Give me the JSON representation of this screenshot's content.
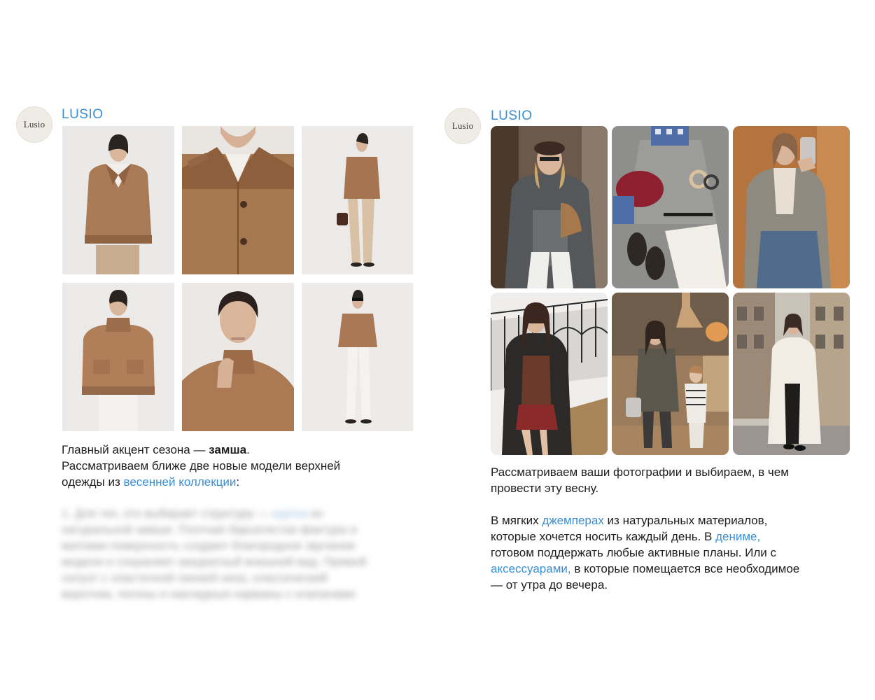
{
  "left_post": {
    "avatar_text": "Lusio",
    "channel_name": "LUSIO",
    "photos": [
      {
        "icon": "suede-bomber-front-photo-icon"
      },
      {
        "icon": "suede-collar-closeup-photo-icon"
      },
      {
        "icon": "suede-jacket-beige-trousers-photo-icon"
      },
      {
        "icon": "suede-jacket-white-trousers-photo-icon"
      },
      {
        "icon": "model-portrait-suede-photo-icon"
      },
      {
        "icon": "full-look-sunglasses-photo-icon"
      }
    ],
    "text": {
      "line1_prefix": "Главный акцент сезона — ",
      "line1_bold": "замша",
      "line1_suffix": ".",
      "line2": "Рассматриваем ближе две новые модели верхней",
      "line3_prefix": "одежды из ",
      "line3_link": "весенней коллекции",
      "line3_suffix": ":"
    },
    "blurred_text": {
      "l1_prefix": "1. Для тех, кто выбирает структуру — ",
      "l1_link": "куртка",
      "l1_suffix": " из",
      "l2": "натуральной замши. Плотная бархатистая фактура и",
      "l3": "матовая поверхность создают благородное звучание",
      "l4": "модели и сохраняют аккуратный внешний вид. Прямой",
      "l5": "силуэт с эластичной линией низа, классический",
      "l6": "воротник, погоны и накладные карманы с клапанами"
    }
  },
  "right_post": {
    "avatar_text": "Lusio",
    "channel_name": "LUSIO",
    "photos": [
      {
        "icon": "street-beret-coat-photo-icon"
      },
      {
        "icon": "flatlay-outfit-photo-icon"
      },
      {
        "icon": "mirror-selfie-blazer-photo-icon"
      },
      {
        "icon": "leather-coat-stairs-photo-icon"
      },
      {
        "icon": "mother-daughter-cafe-photo-icon"
      },
      {
        "icon": "white-coat-street-photo-icon"
      }
    ],
    "text": {
      "p1_line1": "Рассматриваем ваши фотографии и выбираем, в чем",
      "p1_line2": "провести эту весну.",
      "p2_l1_prefix": "В мягких ",
      "p2_l1_link": "джемперах",
      "p2_l1_suffix": " из натуральных материалов,",
      "p2_l2_prefix": "которые хочется носить каждый день. В ",
      "p2_l2_link": "дениме,",
      "p2_l3": "готовом поддержать любые активные планы. Или с",
      "p2_l4_link": "аксессуарами,",
      "p2_l4_suffix": " в которые помещается все необходимое",
      "p2_l5": "— от утра до вечера."
    }
  },
  "colors": {
    "link": "#3a8fd6",
    "suede": "#a27453",
    "studio_bg": "#e9e7e4"
  }
}
